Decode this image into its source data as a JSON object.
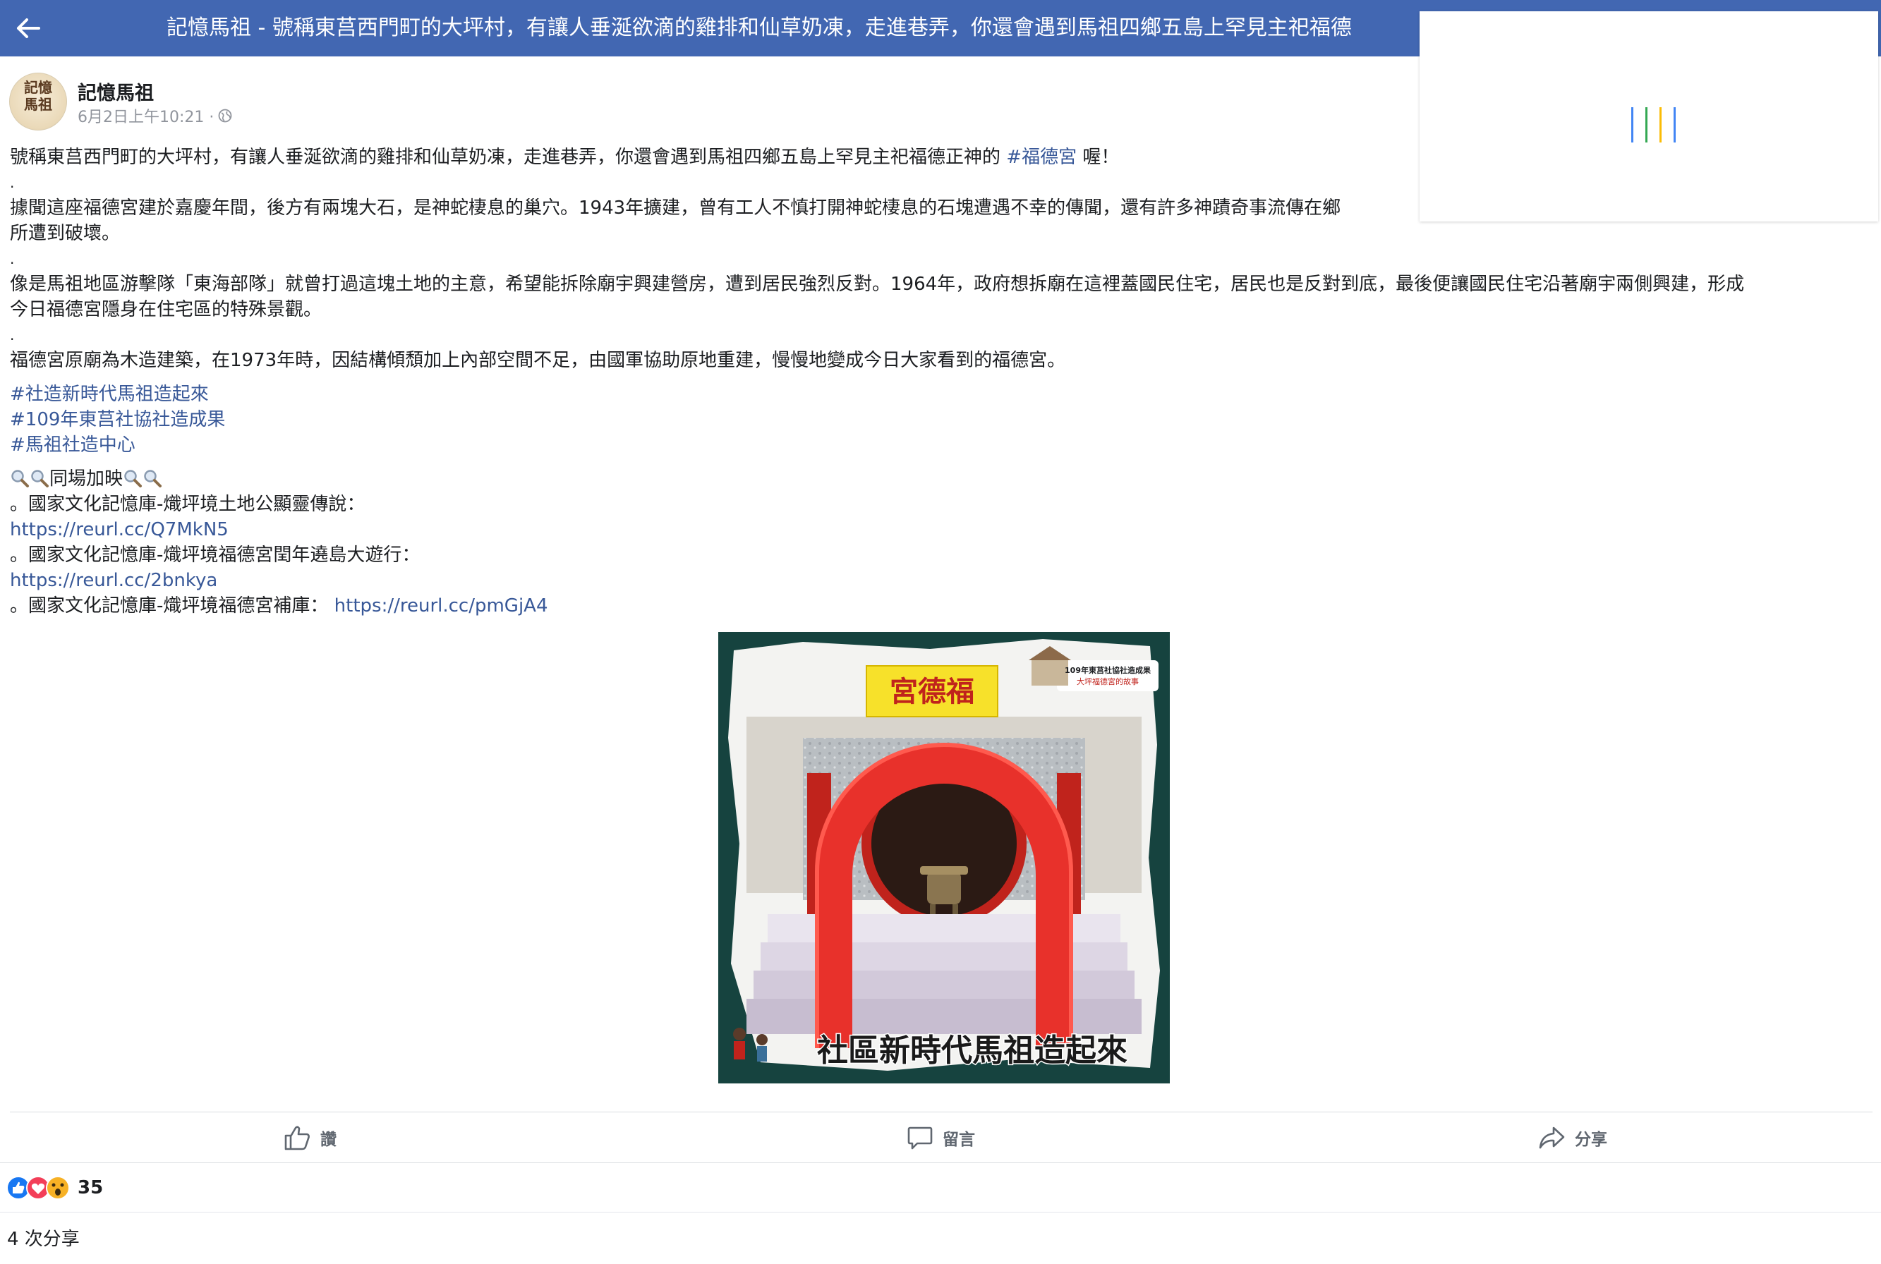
{
  "topbar": {
    "title": "記憶馬祖 - 號稱東莒西門町的大坪村，有讓人垂涎欲滴的雞排和仙草奶凍，走進巷弄，你還會遇到馬祖四鄉五島上罕見主祀福德"
  },
  "post": {
    "page_name": "記憶馬祖",
    "avatar_text": "記憶\n馬祖",
    "timestamp": "6月2日上午10:21 ·",
    "paragraphs": {
      "p1_text": "號稱東莒西門町的大坪村，有讓人垂涎欲滴的雞排和仙草奶凍，走進巷弄，你還會遇到馬祖四鄉五島上罕見主祀福德正神的 ",
      "p1_hashtag": "#福德宮",
      "p1_end": " 喔！",
      "p2_line1": "據聞這座福德宮建於嘉慶年間，後方有兩塊大石，是神蛇棲息的巢穴。1943年擴建，曾有工人不慎打開神蛇棲息的石塊遭遇不幸的傳聞，還有許多神蹟奇事流傳在鄉",
      "p2_line2": "所遭到破壞。",
      "p3_line1": "像是馬祖地區游擊隊「東海部隊」就曾打過這塊土地的主意，希望能拆除廟宇興建營房，遭到居民強烈反對。1964年，政府想拆廟在這裡蓋國民住宅，居民也是反對到底，最後便讓國民住宅沿著廟宇兩側興建，形成",
      "p3_line2": "今日福德宮隱身在住宅區的特殊景觀。",
      "p4": "福德宮原廟為木造建築，在1973年時，因結構傾頹加上內部空間不足，由國軍協助原地重建，慢慢地變成今日大家看到的福德宮。",
      "dot": "."
    },
    "hashtags": [
      "#社造新時代馬祖造起來",
      "#109年東莒社協社造成果",
      "#馬祖社造中心"
    ],
    "extra_title": "同場加映",
    "extra_items": {
      "item1_label": "。國家文化記憶庫-熾坪境土地公顯靈傳說：",
      "item1_link": "https://reurl.cc/Q7MkN5",
      "item2_label": "。國家文化記憶庫-熾坪境福德宮閏年遶島大遊行：",
      "item2_link": "https://reurl.cc/2bnkya",
      "item3_label": "。國家文化記憶庫-熾坪境福德宮補庫：",
      "item3_link": "https://reurl.cc/pmGjA4"
    },
    "image": {
      "sign_text": "宮德福",
      "badge_line1": "109年東莒社協社造成果",
      "badge_line2": "大坪福德宮的故事",
      "caption": "社區新時代馬祖造起來"
    }
  },
  "actions": {
    "like": "讚",
    "comment": "留言",
    "share": "分享"
  },
  "reactions": {
    "count": "35"
  },
  "shares": {
    "label": "4 次分享"
  },
  "colors": {
    "topbar": "#4267b2",
    "link": "#385898",
    "loader": [
      "#4285f4",
      "#34a853",
      "#fbbc05",
      "#ea4335"
    ]
  }
}
